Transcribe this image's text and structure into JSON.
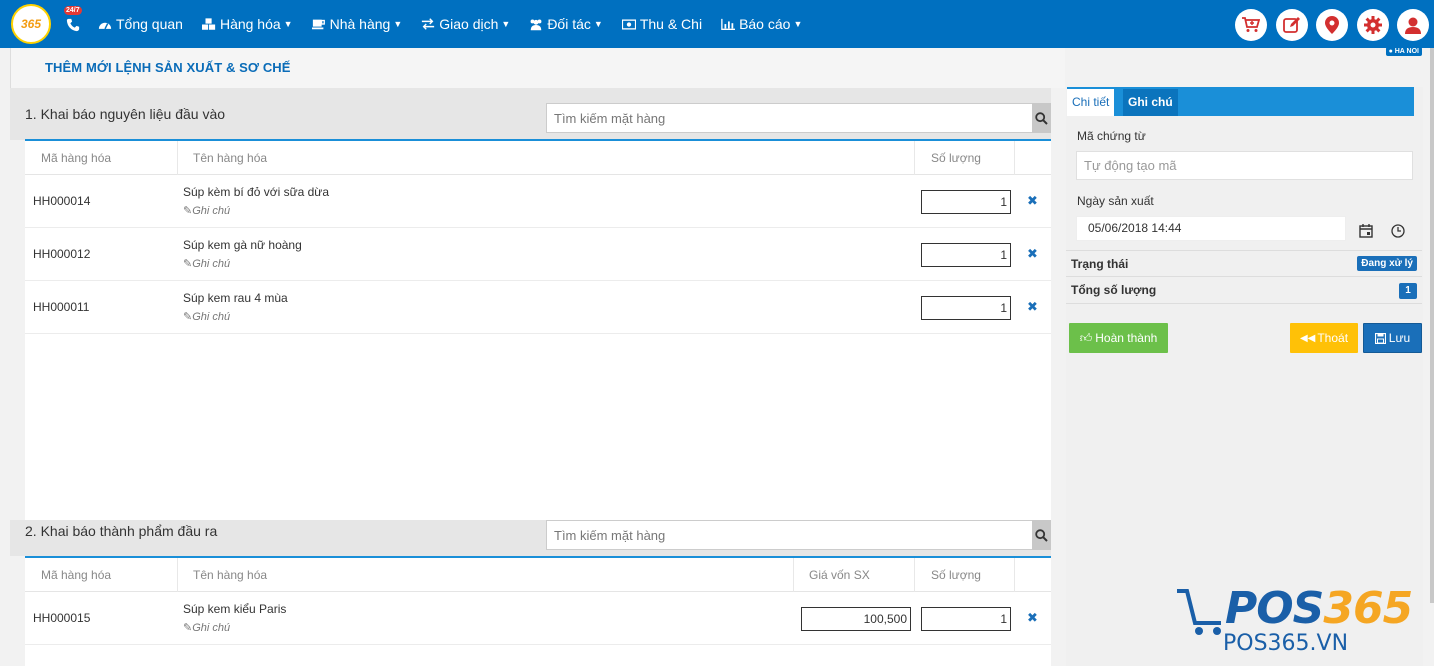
{
  "topbar": {
    "logo_text": "365",
    "hotline_badge": "24/7",
    "nav": [
      {
        "label": "Tổng quan",
        "icon": "dashboard-icon",
        "caret": false
      },
      {
        "label": "Hàng hóa",
        "icon": "cubes-icon",
        "caret": true
      },
      {
        "label": "Nhà hàng",
        "icon": "coffee-icon",
        "caret": true
      },
      {
        "label": "Giao dịch",
        "icon": "exchange-icon",
        "caret": true
      },
      {
        "label": "Đối tác",
        "icon": "users-icon",
        "caret": true
      },
      {
        "label": "Thu & Chi",
        "icon": "money-icon",
        "caret": false
      },
      {
        "label": "Báo cáo",
        "icon": "bar-chart-icon",
        "caret": true
      }
    ],
    "actions": [
      "cart-icon",
      "edit-icon",
      "location-icon",
      "gear-icon",
      "user-icon"
    ],
    "branch": "HA NOI"
  },
  "page": {
    "title": "THÊM MỚI LỆNH SẢN XUẤT & SƠ CHẾ"
  },
  "input_section": {
    "label": "1. Khai báo nguyên liệu đầu vào",
    "search_placeholder": "Tìm kiếm mặt hàng",
    "headers": {
      "code": "Mã hàng hóa",
      "name": "Tên hàng hóa",
      "qty": "Số lượng"
    },
    "rows": [
      {
        "code": "HH000014",
        "name": "Súp kèm bí đỏ với sữa dừa",
        "note": "Ghi chú",
        "qty": "1"
      },
      {
        "code": "HH000012",
        "name": "Súp kem gà nữ hoàng",
        "note": "Ghi chú",
        "qty": "1"
      },
      {
        "code": "HH000011",
        "name": "Súp kem rau 4 mùa",
        "note": "Ghi chú",
        "qty": "1"
      }
    ]
  },
  "output_section": {
    "label": "2. Khai báo thành phẩm đầu ra",
    "search_placeholder": "Tìm kiếm mặt hàng",
    "headers": {
      "code": "Mã hàng hóa",
      "name": "Tên hàng hóa",
      "price": "Giá vốn SX",
      "qty": "Số lượng"
    },
    "rows": [
      {
        "code": "HH000015",
        "name": "Súp kem kiểu Paris",
        "note": "Ghi chú",
        "price": "100,500",
        "qty": "1"
      }
    ]
  },
  "panel": {
    "tabs": [
      "Chi tiết",
      "Ghi chú"
    ],
    "voucher_label": "Mã chứng từ",
    "voucher_placeholder": "Tự động tạo mã",
    "date_label": "Ngày sản xuất",
    "date_value": "05/06/2018 14:44",
    "status_label": "Trạng thái",
    "status_value": "Đang xử lý",
    "total_label": "Tổng số lượng",
    "total_value": "1",
    "complete_button": "Hoàn thành",
    "exit_button": "Thoát",
    "save_button": "Lưu"
  },
  "brand": {
    "name": "POS365",
    "site": "POS365.VN"
  },
  "colors": {
    "primary": "#0070c0",
    "accent": "#1a8fd8",
    "success": "#6cc04a",
    "warning": "#ffc107",
    "brand_orange": "#f39c12"
  }
}
